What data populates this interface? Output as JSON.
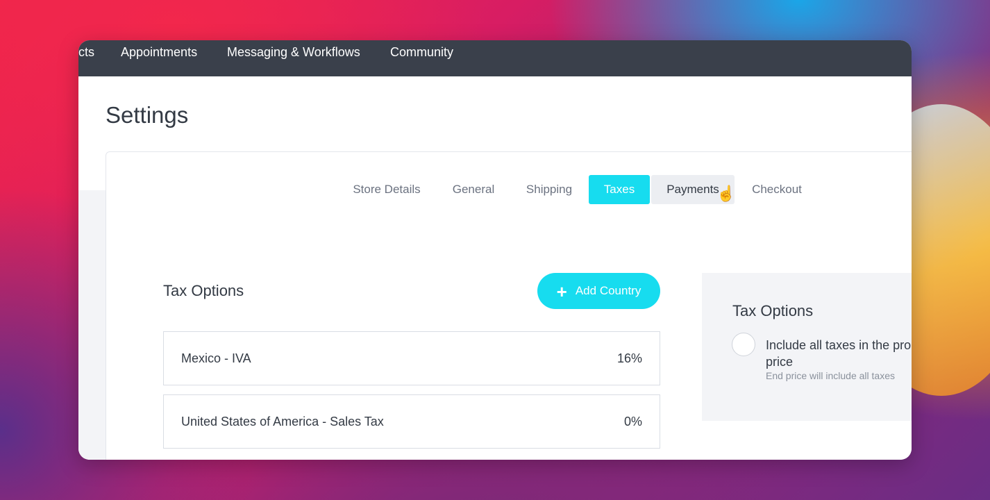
{
  "topnav": {
    "items": [
      "cts",
      "Appointments",
      "Messaging & Workflows",
      "Community"
    ]
  },
  "page": {
    "title": "Settings"
  },
  "tabs": [
    {
      "label": "Store Details"
    },
    {
      "label": "General"
    },
    {
      "label": "Shipping"
    },
    {
      "label": "Taxes",
      "state": "active"
    },
    {
      "label": "Payments",
      "state": "hover"
    },
    {
      "label": "Checkout"
    }
  ],
  "tax_options": {
    "title": "Tax Options",
    "add_button_label": "Add Country",
    "add_button_icon": "plus-icon",
    "rows": [
      {
        "name": "Mexico - IVA",
        "rate": "16%"
      },
      {
        "name": "United States of America - Sales Tax",
        "rate": "0%"
      }
    ]
  },
  "side_panel": {
    "title": "Tax Options",
    "option_label": "Include all taxes in the pro price",
    "option_hint": "End price will include all taxes"
  },
  "colors": {
    "accent": "#17dcef",
    "nav_bg": "#3a404b",
    "text": "#333a44"
  }
}
